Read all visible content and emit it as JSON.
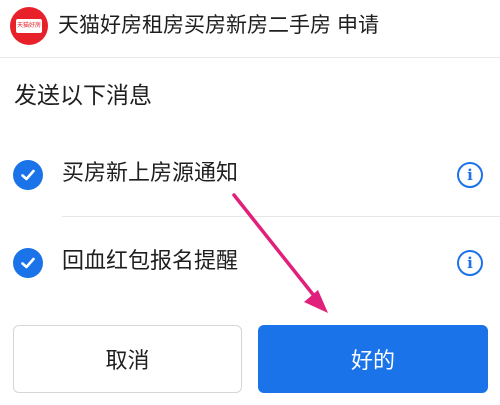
{
  "header": {
    "logo_text": "天猫好房",
    "app_name": "天猫好房租房买房新房二手房",
    "request_label": "申请"
  },
  "section": {
    "title": "发送以下消息"
  },
  "options": [
    {
      "label": "买房新上房源通知",
      "checked": true,
      "info_icon": "i"
    },
    {
      "label": "回血红包报名提醒",
      "checked": true,
      "info_icon": "i"
    }
  ],
  "buttons": {
    "cancel_label": "取消",
    "ok_label": "好的"
  },
  "colors": {
    "accent": "#1a73e8",
    "brand": "#e8202a",
    "annotation_arrow": "#e0207a"
  }
}
